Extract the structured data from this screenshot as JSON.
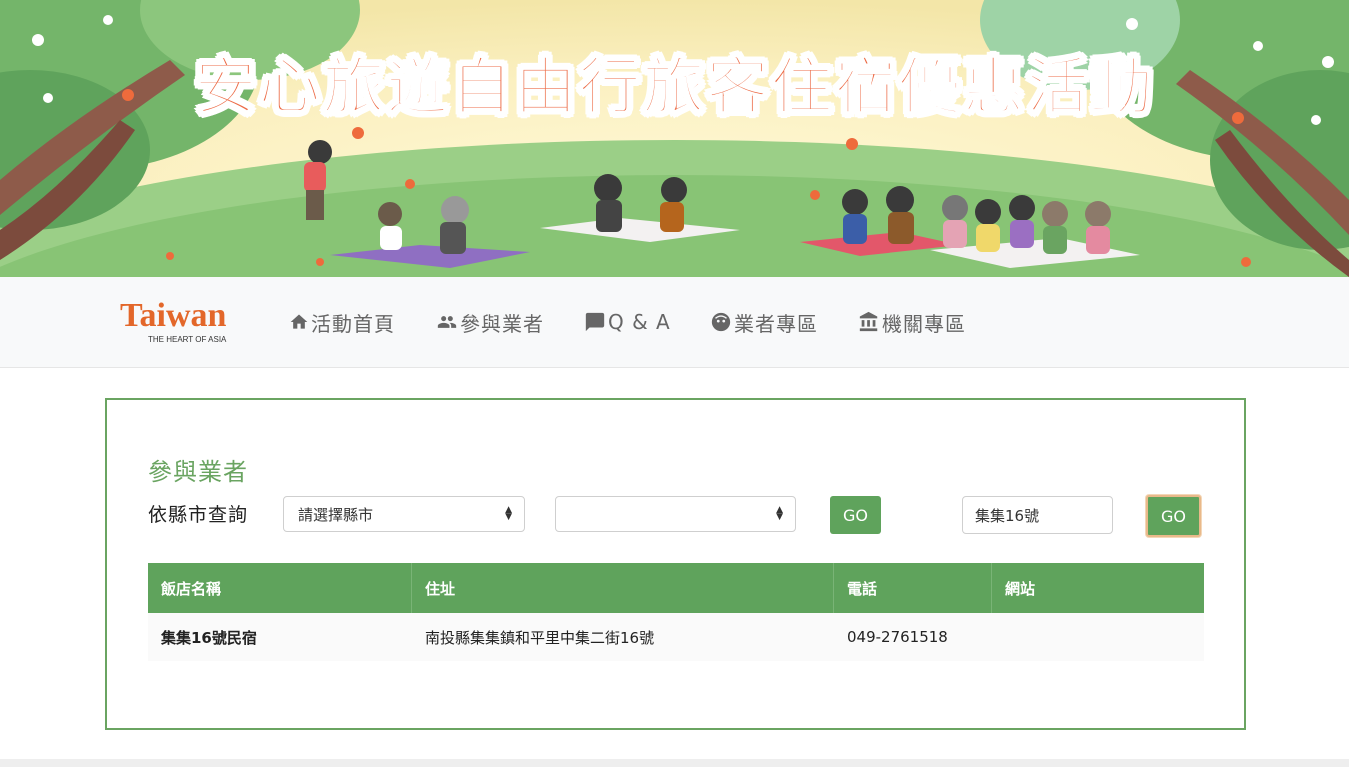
{
  "banner": {
    "title": "安心旅遊自由行旅客住宿優惠活動"
  },
  "navbar": {
    "logo_word": "Taiwan",
    "logo_sub": "THE HEART OF ASIA",
    "items": [
      {
        "label": "活動首頁",
        "icon": "home-icon"
      },
      {
        "label": "參與業者",
        "icon": "users-icon"
      },
      {
        "label": "Q & A",
        "icon": "chat-icon"
      },
      {
        "label": "業者專區",
        "icon": "face-icon"
      },
      {
        "label": "機關專區",
        "icon": "institution-icon"
      }
    ]
  },
  "main": {
    "section_title": "參與業者",
    "filter_label": "依縣市查詢",
    "city_select": {
      "value": "請選擇縣市"
    },
    "district_select": {
      "value": ""
    },
    "go_label": "GO",
    "keyword_input": {
      "value": "集集16號"
    },
    "go_label_2": "GO"
  },
  "table": {
    "headers": [
      "飯店名稱",
      "住址",
      "電話",
      "網站"
    ],
    "rows": [
      {
        "name": "集集16號民宿",
        "address": "南投縣集集鎮和平里中集二街16號",
        "phone": "049-2761518",
        "website": ""
      }
    ]
  },
  "colors": {
    "accent_green": "#5fa35c",
    "banner_title": "#ec6a45",
    "logo_orange": "#e3672a"
  }
}
